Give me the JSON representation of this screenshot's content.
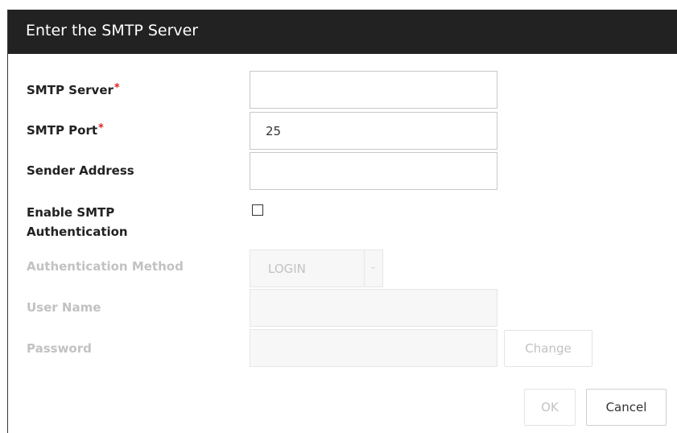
{
  "dialog": {
    "title": "Enter the SMTP Server"
  },
  "form": {
    "smtp_server": {
      "label": "SMTP Server",
      "required_mark": "*",
      "value": ""
    },
    "smtp_port": {
      "label": "SMTP Port",
      "required_mark": "*",
      "value": "25"
    },
    "sender_address": {
      "label": "Sender Address",
      "value": ""
    },
    "enable_auth": {
      "label_line1": "Enable SMTP",
      "label_line2": "Authentication",
      "checked": false
    },
    "auth_method": {
      "label": "Authentication Method",
      "value": "LOGIN",
      "disabled": true
    },
    "user_name": {
      "label": "User Name",
      "value": "",
      "disabled": true
    },
    "password": {
      "label": "Password",
      "value": "",
      "disabled": true,
      "change_label": "Change"
    }
  },
  "buttons": {
    "ok_label": "OK",
    "cancel_label": "Cancel"
  },
  "colors": {
    "titlebar": "#222222",
    "required": "#e02020",
    "disabled_text": "#c2c2c2"
  }
}
